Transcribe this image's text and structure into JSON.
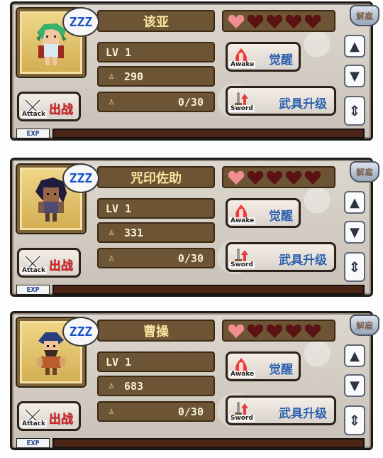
{
  "heroes": [
    {
      "name": "该亚",
      "level": "LV 1",
      "cost": "290",
      "exp": "0/30",
      "status_glyph": "ZZZ",
      "attack_label": "出战",
      "attack_sub": "Attack",
      "awake_label": "觉醒",
      "awake_sub": "Awake",
      "sword_label": "武具升级",
      "sword_sub": "Sword",
      "release_label": "解雇",
      "exp_label": "EXP",
      "exp_progress": 0,
      "hearts_filled": 1,
      "portrait_icon": "green-haired-hero-icon"
    },
    {
      "name": "咒印佐助",
      "level": "LV 1",
      "cost": "331",
      "exp": "0/30",
      "status_glyph": "ZZZ",
      "attack_label": "出战",
      "attack_sub": "Attack",
      "awake_label": "觉醒",
      "awake_sub": "Awake",
      "sword_label": "武具升级",
      "sword_sub": "Sword",
      "release_label": "解雇",
      "exp_label": "EXP",
      "exp_progress": 0,
      "hearts_filled": 1,
      "portrait_icon": "dark-haired-hero-icon"
    },
    {
      "name": "曹操",
      "level": "LV 1",
      "cost": "683",
      "exp": "0/30",
      "status_glyph": "ZZZ",
      "attack_label": "出战",
      "attack_sub": "Attack",
      "awake_label": "觉醒",
      "awake_sub": "Awake",
      "sword_label": "武具升级",
      "sword_sub": "Sword",
      "release_label": "解雇",
      "exp_label": "EXP",
      "exp_progress": 0,
      "hearts_filled": 1,
      "portrait_icon": "bearded-general-icon"
    }
  ],
  "colors": {
    "card_bg": "#d6d0c7",
    "panel_brown": "#6c5435",
    "gold_text": "#f8e59e",
    "blue_text": "#2c5fa8",
    "red_text": "#df2222",
    "heart_active": "#f08e91",
    "heart_inactive": "#5b1212",
    "exp_bar": "#4a2414"
  }
}
